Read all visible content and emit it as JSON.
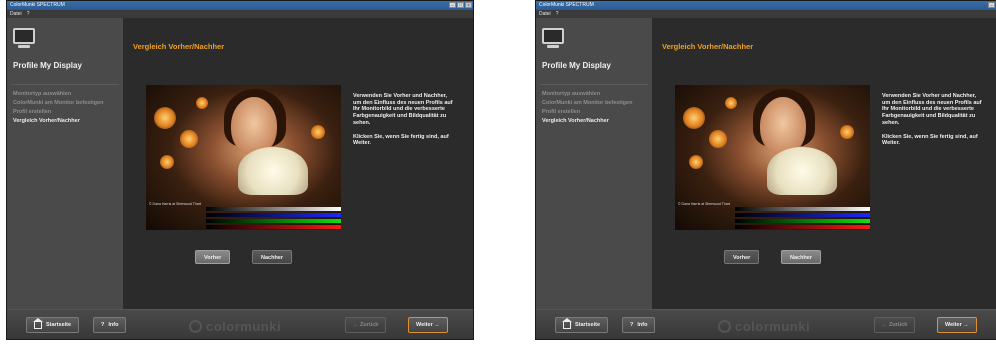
{
  "window": {
    "title": "ColorMunki SPECTRUM",
    "menu": [
      "Datei",
      "?"
    ]
  },
  "sidebar": {
    "profile_title": "Profile My Display",
    "steps": [
      {
        "label": "Monitortyp auswählen"
      },
      {
        "label": "ColorMunki am Monitor befestigen"
      },
      {
        "label": "Profil erstellen"
      },
      {
        "label": "Vergleich Vorher/Nachher"
      }
    ],
    "active_step": 3
  },
  "main": {
    "heading": "Vergleich Vorher/Nachher",
    "photo_credit": "© Dana Harris at Sherwood Thart",
    "description": [
      "Verwenden Sie Vorher und Nachher, um den Einfluss des neuen Profils auf Ihr Monitorbild und die verbesserte Farbgenauigkeit und Bildqualität zu sehen.",
      "Klicken Sie, wenn Sie fertig sind, auf Weiter."
    ],
    "toggle_before": "Vorher",
    "toggle_after": "Nachher"
  },
  "views": [
    {
      "selected": "Vorher"
    },
    {
      "selected": "Nachher"
    }
  ],
  "footer": {
    "home_label": "Startseite",
    "info_label": "Info",
    "info_glyph": "?",
    "logo_text": "colormunki",
    "back_label": "← Zurück",
    "next_label": "Weiter →"
  },
  "colors": {
    "accent": "#f0a020",
    "background": "#2b2b2b",
    "sidebar": "#4a4a4a",
    "gradient_bars": [
      "#ffffff",
      "#1a2aff",
      "#10e010",
      "#ff1818"
    ]
  }
}
